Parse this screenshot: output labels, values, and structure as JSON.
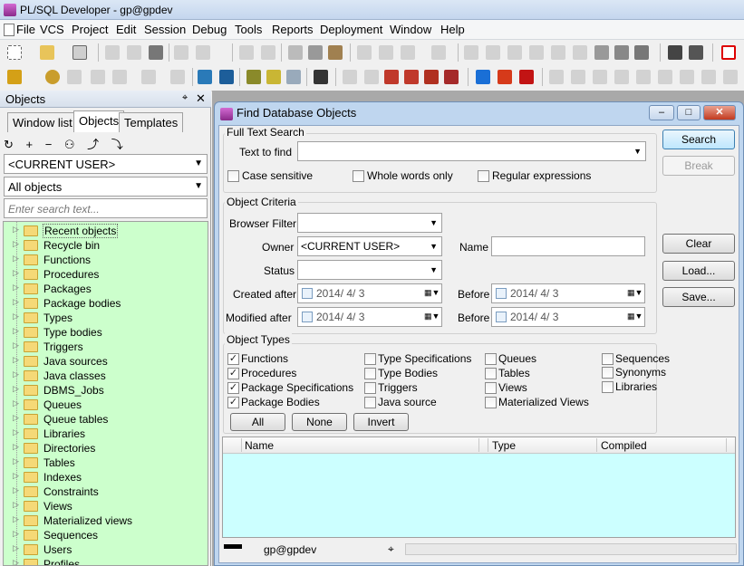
{
  "window": {
    "title": "PL/SQL Developer - gp@gpdev"
  },
  "menu": [
    "File",
    "VCS",
    "Project",
    "Edit",
    "Session",
    "Debug",
    "Tools",
    "Reports",
    "Deployment",
    "Window",
    "Help"
  ],
  "left_panel": {
    "title": "Objects",
    "pin_glyph": "⌖",
    "close_glyph": "✕",
    "tabs": [
      "Window list",
      "Objects",
      "Templates"
    ],
    "active_tab": "Objects",
    "tool_icons": "↻ + − ⚇ ⤴ ⤵",
    "owner_combo": "<CURRENT USER>",
    "filter_combo": "All objects",
    "search_placeholder": "Enter search text...",
    "tree_items": [
      "Recent objects",
      "Recycle bin",
      "Functions",
      "Procedures",
      "Packages",
      "Package bodies",
      "Types",
      "Type bodies",
      "Triggers",
      "Java sources",
      "Java classes",
      "DBMS_Jobs",
      "Queues",
      "Queue tables",
      "Libraries",
      "Directories",
      "Tables",
      "Indexes",
      "Constraints",
      "Views",
      "Materialized views",
      "Sequences",
      "Users",
      "Profiles"
    ]
  },
  "dialog": {
    "title": "Find Database Objects",
    "window_buttons": {
      "minimize": "–",
      "maximize": "□",
      "close": "✕"
    },
    "full_text": {
      "group": "Full Text Search",
      "text_label": "Text to find",
      "text_value": "",
      "case_sensitive": "Case sensitive",
      "whole_words": "Whole words only",
      "regex": "Regular expressions"
    },
    "criteria": {
      "group": "Object Criteria",
      "browser_filter": "Browser Filter",
      "browser_filter_value": "",
      "owner": "Owner",
      "owner_value": "<CURRENT USER>",
      "name": "Name",
      "name_value": "",
      "status": "Status",
      "status_value": "",
      "created_after": "Created after",
      "modified_after": "Modified after",
      "before": "Before",
      "date_value": "2014/  4/  3"
    },
    "types": {
      "group": "Object Types",
      "col1": [
        {
          "label": "Functions",
          "checked": true
        },
        {
          "label": "Procedures",
          "checked": true
        },
        {
          "label": "Package Specifications",
          "checked": true
        },
        {
          "label": "Package Bodies",
          "checked": true
        }
      ],
      "col2": [
        {
          "label": "Type Specifications",
          "checked": false
        },
        {
          "label": "Type Bodies",
          "checked": false
        },
        {
          "label": "Triggers",
          "checked": false
        },
        {
          "label": "Java source",
          "checked": false
        }
      ],
      "col3": [
        {
          "label": "Queues",
          "checked": false
        },
        {
          "label": "Tables",
          "checked": false
        },
        {
          "label": "Views",
          "checked": false
        },
        {
          "label": "Materialized Views",
          "checked": false
        }
      ],
      "col4": [
        {
          "label": "Sequences",
          "checked": false
        },
        {
          "label": "Synonyms",
          "checked": false
        },
        {
          "label": "Libraries",
          "checked": false
        }
      ],
      "all": "All",
      "none": "None",
      "invert": "Invert"
    },
    "buttons": {
      "search": "Search",
      "break": "Break",
      "clear": "Clear",
      "load": "Load...",
      "save": "Save..."
    },
    "results": {
      "columns": [
        "Name",
        "Type",
        "Compiled"
      ]
    },
    "status": {
      "connection": "gp@gpdev",
      "pin_glyph": "⌖"
    }
  },
  "colors": {
    "tree_bg": "#ccffcc",
    "results_bg": "#ccffff",
    "dialog_frame": "#bfd6ef"
  }
}
